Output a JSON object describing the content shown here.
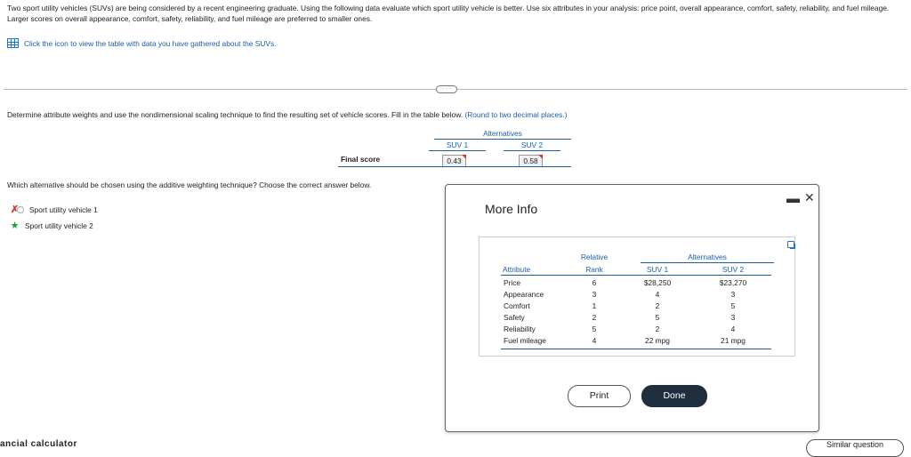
{
  "question": {
    "text": "Two sport utility vehicles (SUVs) are being considered by a recent engineering graduate. Using the following data evaluate which sport utility vehicle is better. Use six attributes in your analysis: price point, overall appearance, comfort, safety, reliability, and fuel mileage. Larger scores on overall appearance, comfort, safety, reliability, and fuel mileage are preferred to smaller ones.",
    "data_link": "Click the icon to view the table with data you have gathered about the SUVs."
  },
  "expander_label": "· · ·",
  "part1": {
    "instruction": "Determine attribute weights and use the nondimensional scaling technique to find the resulting set of vehicle scores. Fill in the table below.",
    "hint": "(Round to two decimal places.)",
    "alternatives_header": "Alternatives",
    "suv1_header": "SUV 1",
    "suv2_header": "SUV 2",
    "row_label": "Final score",
    "suv1_value": "0.43",
    "suv2_value": "0.58"
  },
  "part2": {
    "question": "Which alternative should be chosen using the additive weighting technique? Choose the correct answer below.",
    "options": [
      {
        "label": "Sport utility vehicle 1",
        "status": "incorrect"
      },
      {
        "label": "Sport utility vehicle 2",
        "status": "correct"
      }
    ]
  },
  "footer": {
    "left_tab": "ancial calculator",
    "right_tab": "Similar question"
  },
  "modal": {
    "title": "More Info",
    "minimize": "▬",
    "close": "✕",
    "table": {
      "headers": {
        "attribute": "Attribute",
        "relative_line1": "Relative",
        "relative_line2": "Rank",
        "alternatives": "Alternatives",
        "suv1": "SUV 1",
        "suv2": "SUV 2"
      },
      "rows": [
        {
          "attribute": "Price",
          "rank": "6",
          "suv1": "$28,250",
          "suv2": "$23,270"
        },
        {
          "attribute": "Appearance",
          "rank": "3",
          "suv1": "4",
          "suv2": "3"
        },
        {
          "attribute": "Comfort",
          "rank": "1",
          "suv1": "2",
          "suv2": "5"
        },
        {
          "attribute": "Safety",
          "rank": "2",
          "suv1": "5",
          "suv2": "3"
        },
        {
          "attribute": "Reliability",
          "rank": "5",
          "suv1": "2",
          "suv2": "4"
        },
        {
          "attribute": "Fuel mileage",
          "rank": "4",
          "suv1": "22 mpg",
          "suv2": "21 mpg"
        }
      ]
    },
    "print_label": "Print",
    "done_label": "Done"
  }
}
